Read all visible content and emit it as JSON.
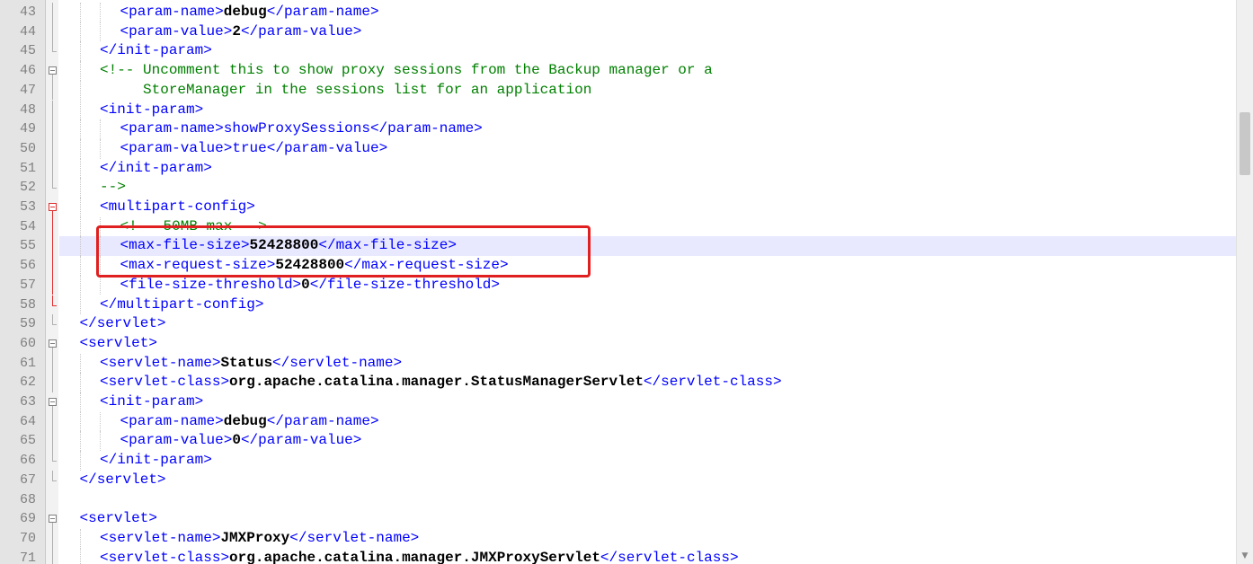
{
  "editor": {
    "lines": [
      {
        "n": "43",
        "fold": "line",
        "indent": 3,
        "parts": [
          [
            "t",
            "<"
          ],
          [
            "n",
            "param-name"
          ],
          [
            "t",
            ">"
          ],
          [
            "v",
            "debug"
          ],
          [
            "t",
            "</"
          ],
          [
            "n",
            "param-name"
          ],
          [
            "t",
            ">"
          ]
        ]
      },
      {
        "n": "44",
        "fold": "line",
        "indent": 3,
        "parts": [
          [
            "t",
            "<"
          ],
          [
            "n",
            "param-value"
          ],
          [
            "t",
            ">"
          ],
          [
            "v",
            "2"
          ],
          [
            "t",
            "</"
          ],
          [
            "n",
            "param-value"
          ],
          [
            "t",
            ">"
          ]
        ]
      },
      {
        "n": "45",
        "fold": "end",
        "indent": 2,
        "parts": [
          [
            "t",
            "</"
          ],
          [
            "n",
            "init-param"
          ],
          [
            "t",
            ">"
          ]
        ]
      },
      {
        "n": "46",
        "fold": "open",
        "indent": 2,
        "parts": [
          [
            "c",
            "<!-- Uncomment this to show proxy sessions from the Backup manager or a"
          ]
        ]
      },
      {
        "n": "47",
        "fold": "line",
        "indent": 2,
        "parts": [
          [
            "c",
            "     StoreManager in the sessions list for an application"
          ]
        ]
      },
      {
        "n": "48",
        "fold": "line",
        "indent": 2,
        "parts": [
          [
            "t",
            "<"
          ],
          [
            "n",
            "init-param"
          ],
          [
            "t",
            ">"
          ]
        ]
      },
      {
        "n": "49",
        "fold": "line",
        "indent": 3,
        "parts": [
          [
            "t",
            "<"
          ],
          [
            "n",
            "param-name"
          ],
          [
            "t",
            ">showProxySessions</"
          ],
          [
            "n",
            "param-name"
          ],
          [
            "t",
            ">"
          ]
        ]
      },
      {
        "n": "50",
        "fold": "line",
        "indent": 3,
        "parts": [
          [
            "t",
            "<"
          ],
          [
            "n",
            "param-value"
          ],
          [
            "t",
            ">true</"
          ],
          [
            "n",
            "param-value"
          ],
          [
            "t",
            ">"
          ]
        ]
      },
      {
        "n": "51",
        "fold": "line",
        "indent": 2,
        "parts": [
          [
            "t",
            "</"
          ],
          [
            "n",
            "init-param"
          ],
          [
            "t",
            ">"
          ]
        ]
      },
      {
        "n": "52",
        "fold": "end",
        "indent": 2,
        "parts": [
          [
            "c",
            "-->"
          ]
        ]
      },
      {
        "n": "53",
        "fold": "open-red",
        "indent": 2,
        "parts": [
          [
            "t",
            "<"
          ],
          [
            "n",
            "multipart-config"
          ],
          [
            "t",
            ">"
          ]
        ]
      },
      {
        "n": "54",
        "fold": "line-red",
        "indent": 3,
        "parts": [
          [
            "c",
            "<!-- 50MB max -->"
          ]
        ]
      },
      {
        "n": "55",
        "fold": "line-red",
        "indent": 3,
        "current": true,
        "parts": [
          [
            "t",
            "<"
          ],
          [
            "n",
            "max-file-size"
          ],
          [
            "t",
            ">"
          ],
          [
            "v",
            "52428800"
          ],
          [
            "t",
            "</"
          ],
          [
            "n",
            "max-file-size"
          ],
          [
            "t",
            ">"
          ]
        ]
      },
      {
        "n": "56",
        "fold": "line-red",
        "indent": 3,
        "parts": [
          [
            "t",
            "<"
          ],
          [
            "n",
            "max-request-size"
          ],
          [
            "t",
            ">"
          ],
          [
            "v",
            "52428800"
          ],
          [
            "t",
            "</"
          ],
          [
            "n",
            "max-request-size"
          ],
          [
            "t",
            ">"
          ]
        ]
      },
      {
        "n": "57",
        "fold": "line-red",
        "indent": 3,
        "parts": [
          [
            "t",
            "<"
          ],
          [
            "n",
            "file-size-threshold"
          ],
          [
            "t",
            ">"
          ],
          [
            "v",
            "0"
          ],
          [
            "t",
            "</"
          ],
          [
            "n",
            "file-size-threshold"
          ],
          [
            "t",
            ">"
          ]
        ]
      },
      {
        "n": "58",
        "fold": "end-red",
        "indent": 2,
        "parts": [
          [
            "t",
            "</"
          ],
          [
            "n",
            "multipart-config"
          ],
          [
            "t",
            ">"
          ]
        ]
      },
      {
        "n": "59",
        "fold": "end",
        "indent": 1,
        "parts": [
          [
            "t",
            "</"
          ],
          [
            "n",
            "servlet"
          ],
          [
            "t",
            ">"
          ]
        ]
      },
      {
        "n": "60",
        "fold": "open",
        "indent": 1,
        "parts": [
          [
            "t",
            "<"
          ],
          [
            "n",
            "servlet"
          ],
          [
            "t",
            ">"
          ]
        ]
      },
      {
        "n": "61",
        "fold": "line",
        "indent": 2,
        "parts": [
          [
            "t",
            "<"
          ],
          [
            "n",
            "servlet-name"
          ],
          [
            "t",
            ">"
          ],
          [
            "v",
            "Status"
          ],
          [
            "t",
            "</"
          ],
          [
            "n",
            "servlet-name"
          ],
          [
            "t",
            ">"
          ]
        ]
      },
      {
        "n": "62",
        "fold": "line",
        "indent": 2,
        "parts": [
          [
            "t",
            "<"
          ],
          [
            "n",
            "servlet-class"
          ],
          [
            "t",
            ">"
          ],
          [
            "v",
            "org.apache.catalina.manager.StatusManagerServlet"
          ],
          [
            "t",
            "</"
          ],
          [
            "n",
            "servlet-class"
          ],
          [
            "t",
            ">"
          ]
        ]
      },
      {
        "n": "63",
        "fold": "open",
        "indent": 2,
        "parts": [
          [
            "t",
            "<"
          ],
          [
            "n",
            "init-param"
          ],
          [
            "t",
            ">"
          ]
        ]
      },
      {
        "n": "64",
        "fold": "line",
        "indent": 3,
        "parts": [
          [
            "t",
            "<"
          ],
          [
            "n",
            "param-name"
          ],
          [
            "t",
            ">"
          ],
          [
            "v",
            "debug"
          ],
          [
            "t",
            "</"
          ],
          [
            "n",
            "param-name"
          ],
          [
            "t",
            ">"
          ]
        ]
      },
      {
        "n": "65",
        "fold": "line",
        "indent": 3,
        "parts": [
          [
            "t",
            "<"
          ],
          [
            "n",
            "param-value"
          ],
          [
            "t",
            ">"
          ],
          [
            "v",
            "0"
          ],
          [
            "t",
            "</"
          ],
          [
            "n",
            "param-value"
          ],
          [
            "t",
            ">"
          ]
        ]
      },
      {
        "n": "66",
        "fold": "end",
        "indent": 2,
        "parts": [
          [
            "t",
            "</"
          ],
          [
            "n",
            "init-param"
          ],
          [
            "t",
            ">"
          ]
        ]
      },
      {
        "n": "67",
        "fold": "end",
        "indent": 1,
        "parts": [
          [
            "t",
            "</"
          ],
          [
            "n",
            "servlet"
          ],
          [
            "t",
            ">"
          ]
        ]
      },
      {
        "n": "68",
        "fold": "none",
        "indent": 0,
        "parts": []
      },
      {
        "n": "69",
        "fold": "open",
        "indent": 1,
        "parts": [
          [
            "t",
            "<"
          ],
          [
            "n",
            "servlet"
          ],
          [
            "t",
            ">"
          ]
        ]
      },
      {
        "n": "70",
        "fold": "line",
        "indent": 2,
        "parts": [
          [
            "t",
            "<"
          ],
          [
            "n",
            "servlet-name"
          ],
          [
            "t",
            ">"
          ],
          [
            "v",
            "JMXProxy"
          ],
          [
            "t",
            "</"
          ],
          [
            "n",
            "servlet-name"
          ],
          [
            "t",
            ">"
          ]
        ]
      },
      {
        "n": "71",
        "fold": "line",
        "indent": 2,
        "parts": [
          [
            "t",
            "<"
          ],
          [
            "n",
            "servlet-class"
          ],
          [
            "t",
            ">"
          ],
          [
            "v",
            "org.apache.catalina.manager.JMXProxyServlet"
          ],
          [
            "t",
            "</"
          ],
          [
            "n",
            "servlet-class"
          ],
          [
            "t",
            ">"
          ]
        ]
      }
    ]
  },
  "colors": {
    "tag": "#0000ff",
    "comment": "#008000",
    "highlight": "#e02020",
    "current_line": "#e8e8ff"
  }
}
